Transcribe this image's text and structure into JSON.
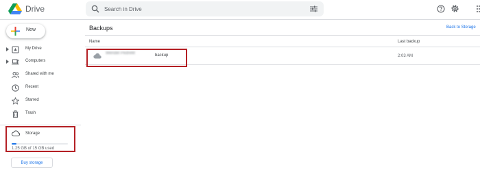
{
  "header": {
    "app_title": "Drive",
    "search_placeholder": "Search in Drive",
    "icons": [
      "search-icon",
      "filter-icon",
      "help-icon",
      "gear-icon",
      "apps-icon"
    ]
  },
  "sidebar": {
    "new_label": "New",
    "items": [
      {
        "label": "My Drive",
        "icon": "my-drive-icon",
        "expandable": true
      },
      {
        "label": "Computers",
        "icon": "computers-icon",
        "expandable": true
      },
      {
        "label": "Shared with me",
        "icon": "shared-icon",
        "expandable": false
      },
      {
        "label": "Recent",
        "icon": "clock-icon",
        "expandable": false
      },
      {
        "label": "Starred",
        "icon": "star-icon",
        "expandable": false
      },
      {
        "label": "Trash",
        "icon": "trash-icon",
        "expandable": false
      }
    ],
    "storage": {
      "label": "Storage",
      "usage_text": "1.25 GB of 15 GB used",
      "used_fraction": 0.083
    },
    "buy_storage_label": "Buy storage"
  },
  "main": {
    "title": "Backups",
    "back_link": "Back to Storage",
    "columns": {
      "name": "Name",
      "last_backup": "Last backup"
    },
    "rows": [
      {
        "name_redacted": "Wendel PedreM",
        "name_suffix": "backup",
        "last_backup": "2:03 AM",
        "icon": "cloud-icon"
      }
    ]
  },
  "colors": {
    "accent": "#1a73e8",
    "highlight_box": "#b41f24",
    "divider": "#dadce0",
    "search_bg": "#f1f3f4"
  }
}
